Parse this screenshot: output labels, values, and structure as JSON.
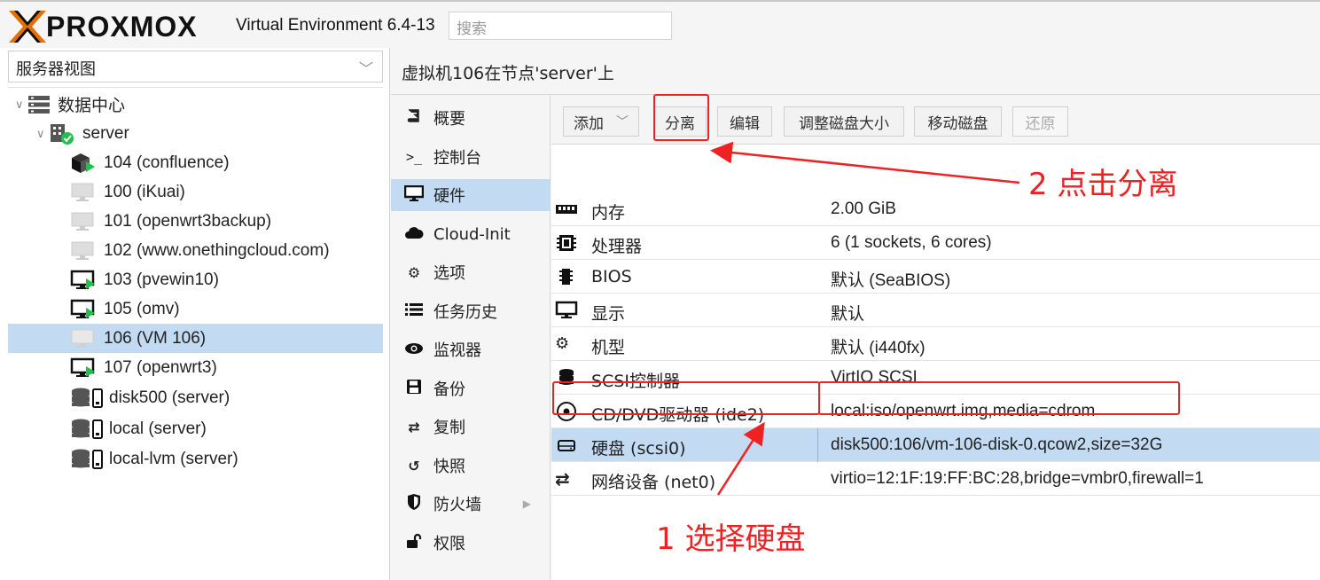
{
  "topbar": {
    "logo_text": "PROXMOX",
    "version": "Virtual Environment 6.4-13",
    "search_placeholder": "搜索"
  },
  "left": {
    "view_select": "服务器视图",
    "tree": [
      {
        "label": "数据中心",
        "icon": "datacenter-icon"
      },
      {
        "label": "server",
        "icon": "server-node-icon"
      },
      {
        "label": "104 (confluence)",
        "icon": "container-running-icon"
      },
      {
        "label": "100 (iKuai)",
        "icon": "vm-stopped-icon"
      },
      {
        "label": "101 (openwrt3backup)",
        "icon": "vm-stopped-icon"
      },
      {
        "label": "102 (www.onethingcloud.com)",
        "icon": "vm-stopped-icon"
      },
      {
        "label": "103 (pvewin10)",
        "icon": "vm-running-icon"
      },
      {
        "label": "105 (omv)",
        "icon": "vm-running-icon"
      },
      {
        "label": "106 (VM 106)",
        "icon": "vm-stopped-icon",
        "selected": true
      },
      {
        "label": "107 (openwrt3)",
        "icon": "vm-running-icon"
      },
      {
        "label": "disk500 (server)",
        "icon": "storage-icon"
      },
      {
        "label": "local (server)",
        "icon": "storage-icon"
      },
      {
        "label": "local-lvm (server)",
        "icon": "storage-icon"
      }
    ]
  },
  "right": {
    "title": "虚拟机106在节点'server'上",
    "nav": [
      {
        "label": "概要",
        "icon": "book-icon"
      },
      {
        "label": "控制台",
        "icon": "terminal-icon"
      },
      {
        "label": "硬件",
        "icon": "monitor-icon",
        "selected": true
      },
      {
        "label": "Cloud-Init",
        "icon": "cloud-icon"
      },
      {
        "label": "选项",
        "icon": "gear-icon"
      },
      {
        "label": "任务历史",
        "icon": "list-icon"
      },
      {
        "label": "监视器",
        "icon": "eye-icon"
      },
      {
        "label": "备份",
        "icon": "floppy-icon"
      },
      {
        "label": "复制",
        "icon": "retweet-icon"
      },
      {
        "label": "快照",
        "icon": "history-icon"
      },
      {
        "label": "防火墙",
        "icon": "shield-icon",
        "has_submenu": true
      },
      {
        "label": "权限",
        "icon": "unlock-icon"
      }
    ],
    "toolbar": {
      "add": "添加",
      "detach": "分离",
      "edit": "编辑",
      "resize": "调整磁盘大小",
      "move": "移动磁盘",
      "revert": "还原"
    },
    "hardware": [
      {
        "key": "内存",
        "value": "2.00 GiB",
        "icon": "memory-icon"
      },
      {
        "key": "处理器",
        "value": "6 (1 sockets, 6 cores)",
        "icon": "cpu-icon"
      },
      {
        "key": "BIOS",
        "value": "默认 (SeaBIOS)",
        "icon": "bios-icon"
      },
      {
        "key": "显示",
        "value": "默认",
        "icon": "display-icon"
      },
      {
        "key": "机型",
        "value": "默认 (i440fx)",
        "icon": "cogs-icon"
      },
      {
        "key": "SCSI控制器",
        "value": "VirtIO SCSI",
        "icon": "database-icon"
      },
      {
        "key": "CD/DVD驱动器 (ide2)",
        "value": "local:iso/openwrt.img,media=cdrom",
        "icon": "cdrom-icon"
      },
      {
        "key": "硬盘 (scsi0)",
        "value": "disk500:106/vm-106-disk-0.qcow2,size=32G",
        "icon": "hdd-icon",
        "selected": true
      },
      {
        "key": "网络设备 (net0)",
        "value": "virtio=12:1F:19:FF:BC:28,bridge=vmbr0,firewall=1",
        "icon": "exchange-icon"
      }
    ]
  },
  "annotations": {
    "step1": "1  选择硬盘",
    "step2": "2  点击分离"
  },
  "colors": {
    "accent_orange": "#e57000",
    "selection_blue": "#c2dbf3",
    "annotation_red": "#e22222",
    "running_green": "#21bf4b"
  }
}
